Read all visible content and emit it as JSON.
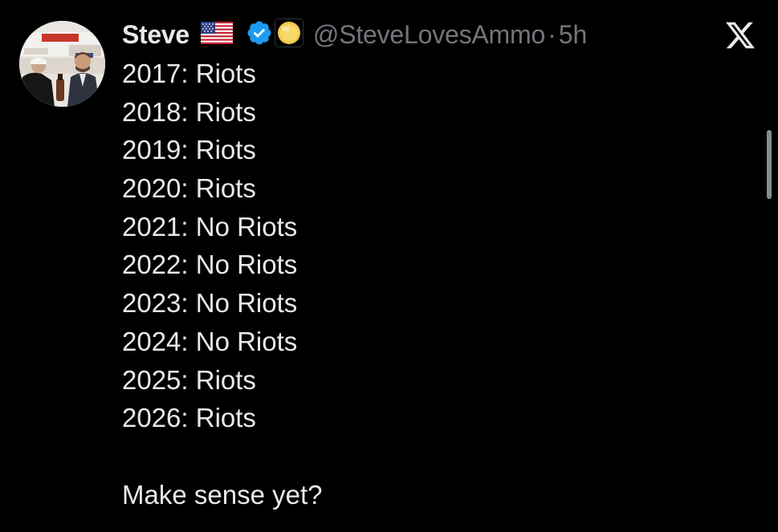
{
  "user": {
    "name": "Steve",
    "handle": "@SteveLovesAmmo",
    "separator": "·",
    "time": "5h",
    "badges": [
      "us-flag-icon",
      "verified-icon",
      "gold-coin-icon"
    ]
  },
  "tweet": {
    "lines": [
      "2017: Riots",
      "2018: Riots",
      "2019: Riots",
      "2020: Riots",
      "2021: No Riots",
      "2022: No Riots",
      "2023: No Riots",
      "2024: No Riots",
      "2025: Riots",
      "2026: Riots"
    ],
    "closing": "Make sense yet?"
  },
  "icons": {
    "platform_logo": "x-logo-icon"
  },
  "colors": {
    "background": "#000000",
    "text": "#e7e9ea",
    "muted": "#71767b",
    "verified": "#1d9bf0",
    "coin": "#f2c94c"
  }
}
